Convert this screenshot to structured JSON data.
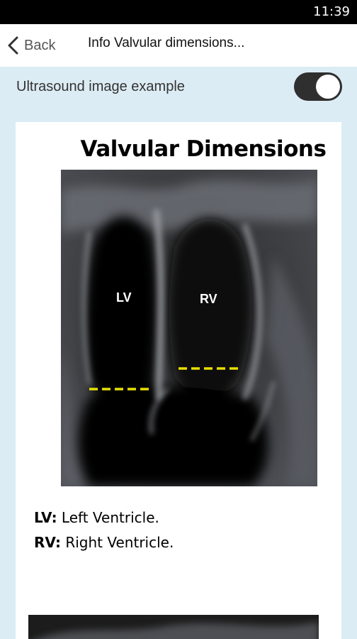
{
  "status_bar": {
    "time": "11:39"
  },
  "nav": {
    "back_label": "Back",
    "title": "Info Valvular dimensions..."
  },
  "toggle": {
    "label": "Ultrasound image example",
    "state": "on"
  },
  "card": {
    "heading": "Valvular Dimensions",
    "image_labels": {
      "lv": "LV",
      "rv": "RV"
    },
    "legend": [
      {
        "abbr": "LV:",
        "text": " Left Ventricle."
      },
      {
        "abbr": "RV:",
        "text": " Right Ventricle."
      }
    ]
  },
  "colors": {
    "toggle_track": "#2f2f2f",
    "page_background": "#dcecf4",
    "measurement_line": "#e8e000"
  }
}
